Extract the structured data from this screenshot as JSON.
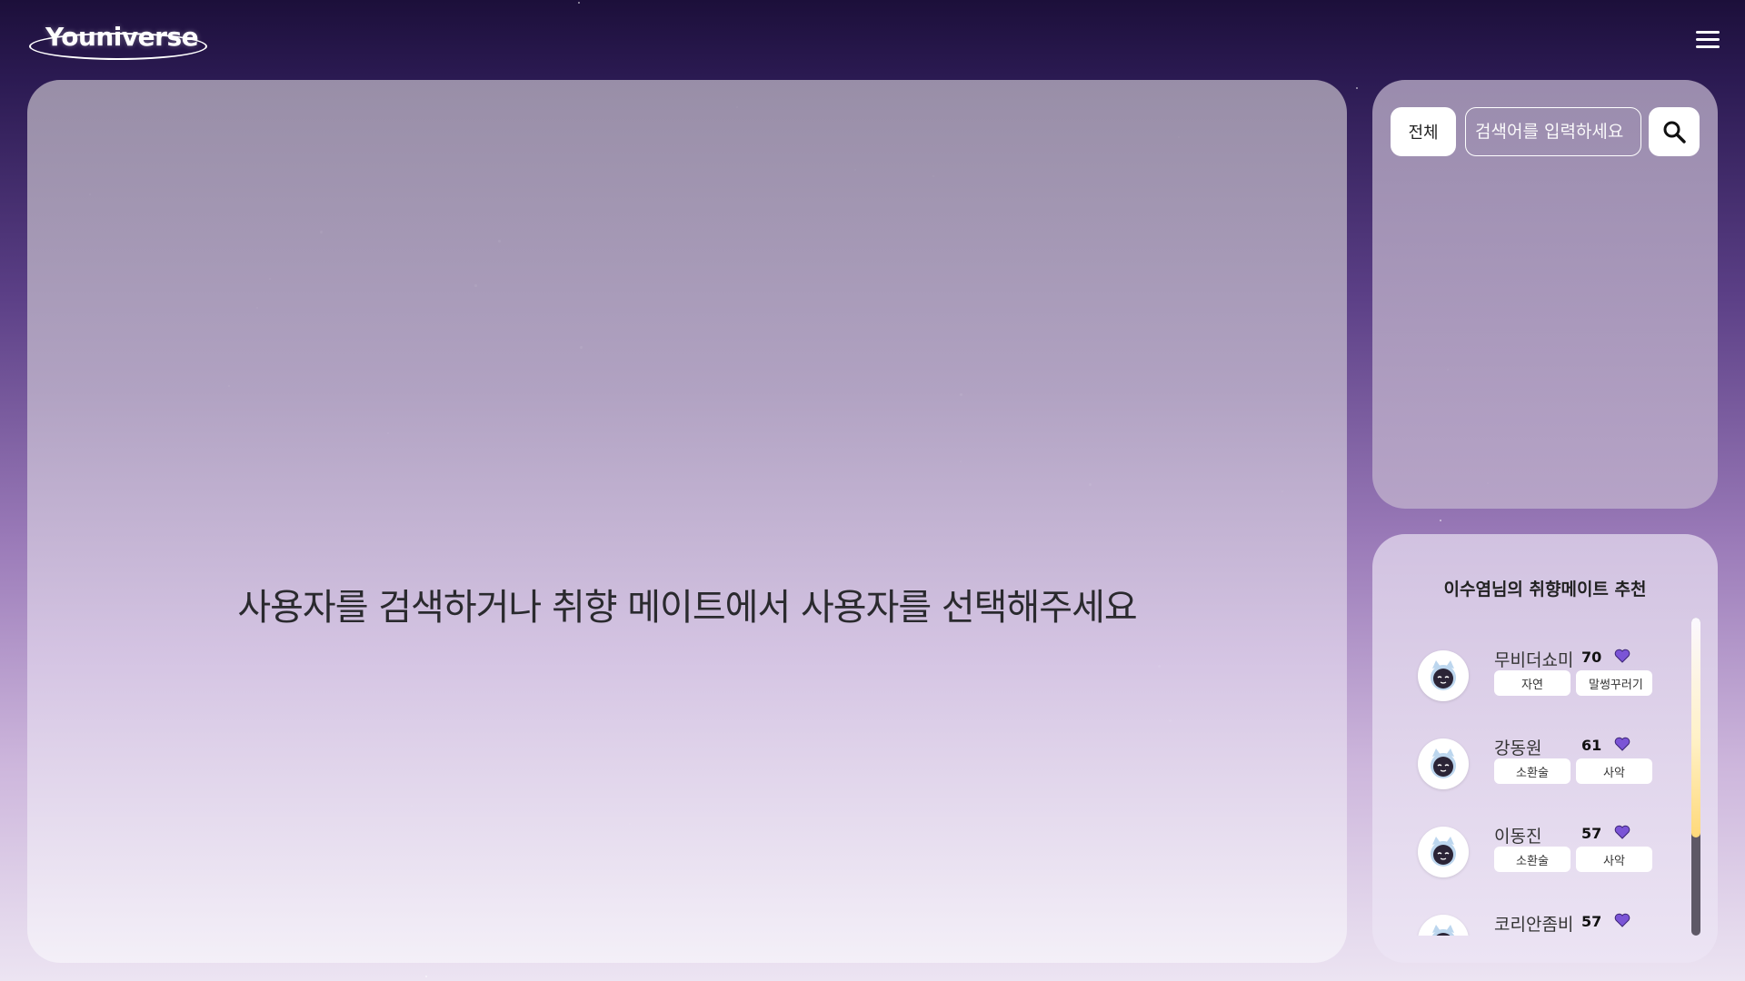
{
  "app": {
    "logo_text": "Youniverse",
    "menu_icon": "hamburger-menu-icon"
  },
  "main": {
    "message": "사용자를 검색하거나 취향 메이트에서 사용자를 선택해주세요"
  },
  "search": {
    "filter_label": "전체",
    "placeholder": "검색어를 입력하세요",
    "search_icon": "magnifier-icon"
  },
  "mates": {
    "title": "이수염님의 취향메이트 추천",
    "items": [
      {
        "name": "무비더쇼미",
        "score": "70",
        "tags": [
          "자연",
          "말썽꾸러기"
        ]
      },
      {
        "name": "강동원",
        "score": "61",
        "tags": [
          "소환술",
          "사악"
        ]
      },
      {
        "name": "이동진",
        "score": "57",
        "tags": [
          "소환술",
          "사악"
        ]
      },
      {
        "name": "코리안좀비",
        "score": "57",
        "tags": [
          "",
          ""
        ]
      }
    ]
  },
  "colors": {
    "accent_heart": "#7b54d6",
    "scrollbar_thumb": "#ffd97a"
  }
}
